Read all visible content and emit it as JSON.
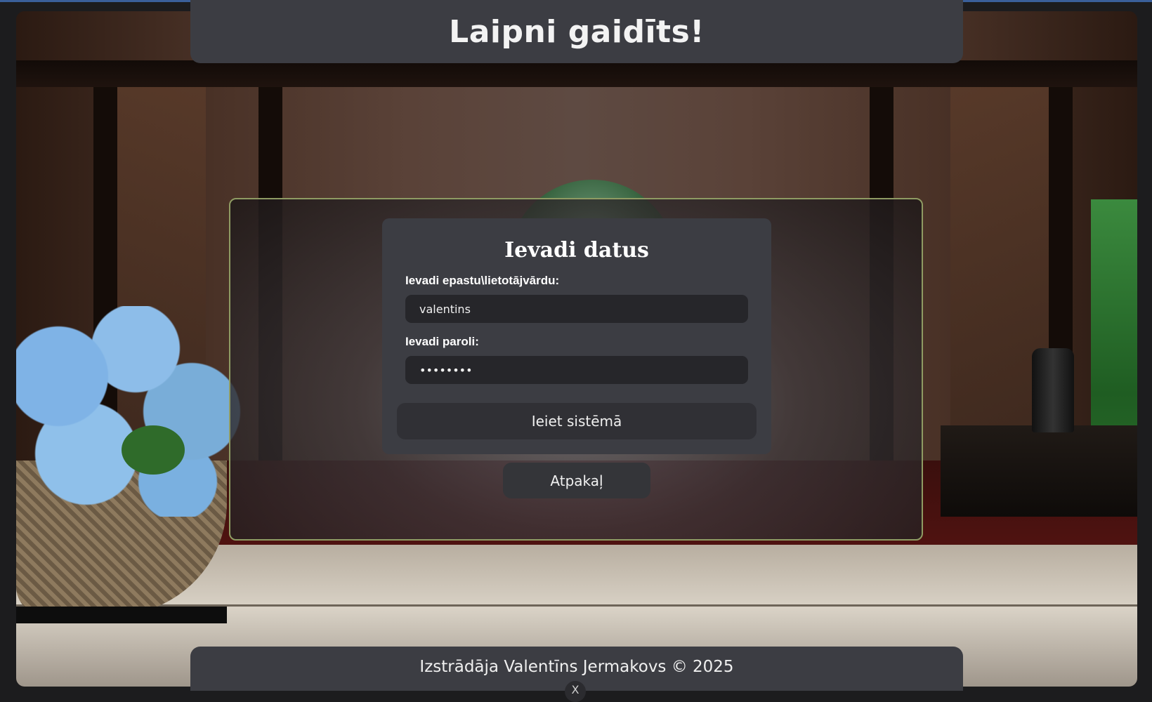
{
  "header": {
    "title": "Laipni gaidīts!"
  },
  "login_form": {
    "title": "Ievadi datus",
    "username_label": "Ievadi epastu\\lietotājvārdu:",
    "username_value": "valentins",
    "password_label": "Ievadi paroli:",
    "password_value": "••••••••",
    "submit_label": "Ieiet sistēmā"
  },
  "back_button": {
    "label": "Atpakaļ"
  },
  "footer": {
    "text": "Izstrādāja Valentīns Jermakovs © 2025",
    "close_glyph": "X"
  },
  "colors": {
    "card": "#3c3d43",
    "input": "#26262a",
    "frame_border": "#8f9b63",
    "text": "#ffffff"
  }
}
